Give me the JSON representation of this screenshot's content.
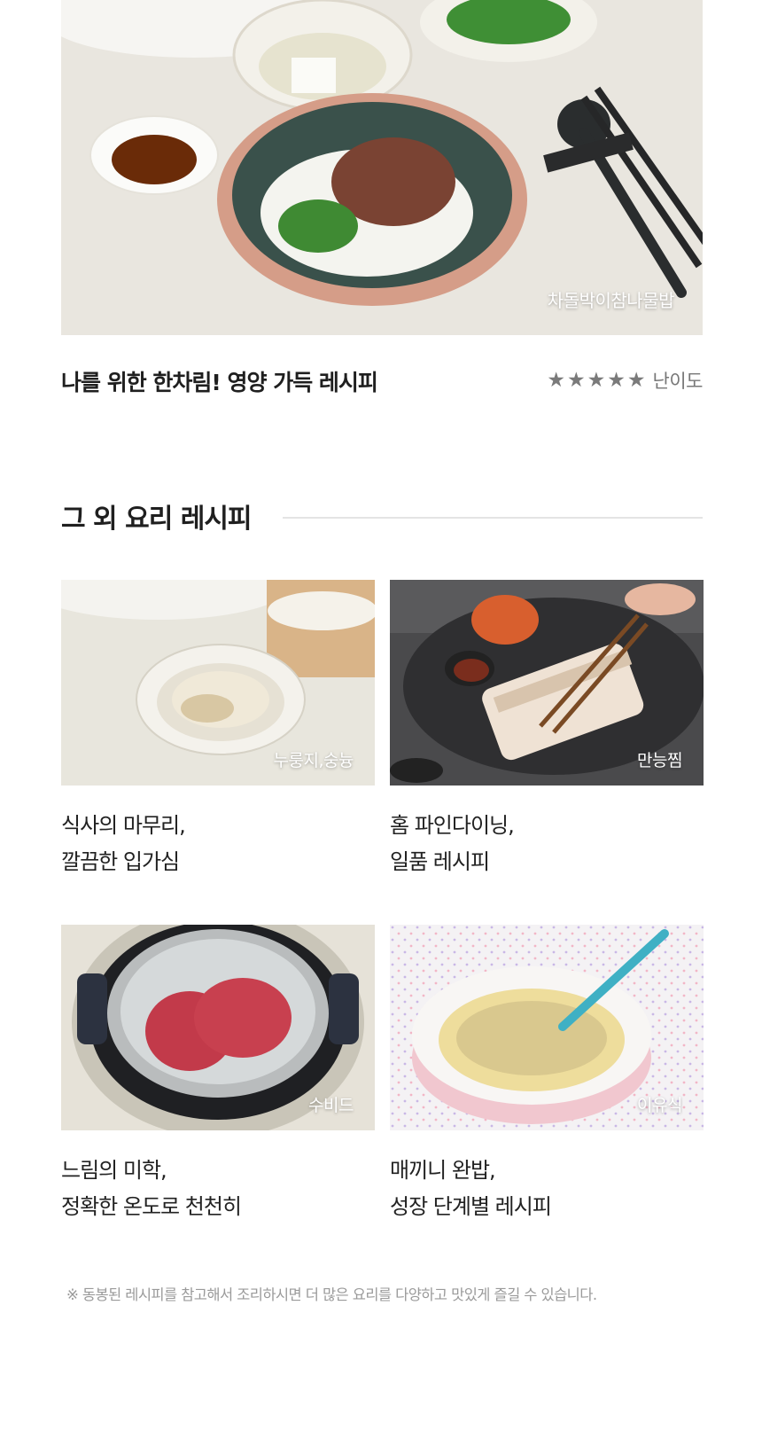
{
  "hero": {
    "photo_label": "차돌박이참나물밥",
    "title": "나를 위한 한차림! 영양 가득 레시피",
    "rating": 5,
    "stars": [
      "★",
      "★",
      "★",
      "★",
      "★"
    ],
    "difficulty_label": "난이도"
  },
  "section": {
    "title": "그 외 요리 레시피"
  },
  "recipes": [
    {
      "photo_label": "누룽지,숭늉",
      "line1": "식사의 마무리,",
      "line2": "깔끔한 입가심"
    },
    {
      "photo_label": "만능찜",
      "line1": "홈 파인다이닝,",
      "line2": "일품 레시피"
    },
    {
      "photo_label": "수비드",
      "line1": "느림의 미학,",
      "line2": "정확한 온도로 천천히"
    },
    {
      "photo_label": "이유식",
      "line1": "매끼니 완밥,",
      "line2": "성장 단계별 레시피"
    }
  ],
  "footnote": "※ 동봉된 레시피를 참고해서 조리하시면 더 많은 요리를 다양하고 맛있게 즐길 수 있습니다.",
  "colors": {
    "star": "#7a7a7a",
    "rule": "#e4e4e4",
    "footnote": "#9a9a9a"
  }
}
